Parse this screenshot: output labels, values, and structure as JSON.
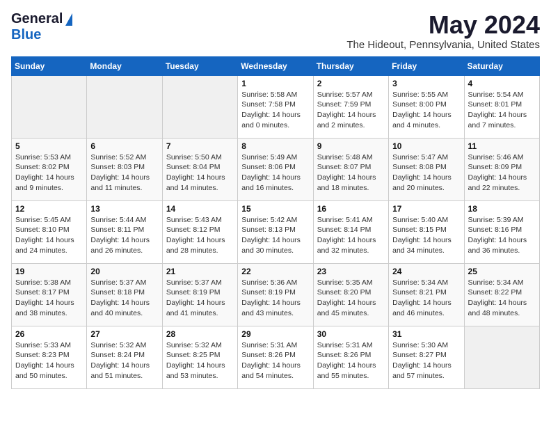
{
  "header": {
    "logo_general": "General",
    "logo_blue": "Blue",
    "title": "May 2024",
    "subtitle": "The Hideout, Pennsylvania, United States"
  },
  "days_of_week": [
    "Sunday",
    "Monday",
    "Tuesday",
    "Wednesday",
    "Thursday",
    "Friday",
    "Saturday"
  ],
  "weeks": [
    {
      "days": [
        {
          "num": "",
          "info": "",
          "empty": true
        },
        {
          "num": "",
          "info": "",
          "empty": true
        },
        {
          "num": "",
          "info": "",
          "empty": true
        },
        {
          "num": "1",
          "info": "Sunrise: 5:58 AM\nSunset: 7:58 PM\nDaylight: 14 hours\nand 0 minutes."
        },
        {
          "num": "2",
          "info": "Sunrise: 5:57 AM\nSunset: 7:59 PM\nDaylight: 14 hours\nand 2 minutes."
        },
        {
          "num": "3",
          "info": "Sunrise: 5:55 AM\nSunset: 8:00 PM\nDaylight: 14 hours\nand 4 minutes."
        },
        {
          "num": "4",
          "info": "Sunrise: 5:54 AM\nSunset: 8:01 PM\nDaylight: 14 hours\nand 7 minutes."
        }
      ]
    },
    {
      "days": [
        {
          "num": "5",
          "info": "Sunrise: 5:53 AM\nSunset: 8:02 PM\nDaylight: 14 hours\nand 9 minutes."
        },
        {
          "num": "6",
          "info": "Sunrise: 5:52 AM\nSunset: 8:03 PM\nDaylight: 14 hours\nand 11 minutes."
        },
        {
          "num": "7",
          "info": "Sunrise: 5:50 AM\nSunset: 8:04 PM\nDaylight: 14 hours\nand 14 minutes."
        },
        {
          "num": "8",
          "info": "Sunrise: 5:49 AM\nSunset: 8:06 PM\nDaylight: 14 hours\nand 16 minutes."
        },
        {
          "num": "9",
          "info": "Sunrise: 5:48 AM\nSunset: 8:07 PM\nDaylight: 14 hours\nand 18 minutes."
        },
        {
          "num": "10",
          "info": "Sunrise: 5:47 AM\nSunset: 8:08 PM\nDaylight: 14 hours\nand 20 minutes."
        },
        {
          "num": "11",
          "info": "Sunrise: 5:46 AM\nSunset: 8:09 PM\nDaylight: 14 hours\nand 22 minutes."
        }
      ]
    },
    {
      "days": [
        {
          "num": "12",
          "info": "Sunrise: 5:45 AM\nSunset: 8:10 PM\nDaylight: 14 hours\nand 24 minutes."
        },
        {
          "num": "13",
          "info": "Sunrise: 5:44 AM\nSunset: 8:11 PM\nDaylight: 14 hours\nand 26 minutes."
        },
        {
          "num": "14",
          "info": "Sunrise: 5:43 AM\nSunset: 8:12 PM\nDaylight: 14 hours\nand 28 minutes."
        },
        {
          "num": "15",
          "info": "Sunrise: 5:42 AM\nSunset: 8:13 PM\nDaylight: 14 hours\nand 30 minutes."
        },
        {
          "num": "16",
          "info": "Sunrise: 5:41 AM\nSunset: 8:14 PM\nDaylight: 14 hours\nand 32 minutes."
        },
        {
          "num": "17",
          "info": "Sunrise: 5:40 AM\nSunset: 8:15 PM\nDaylight: 14 hours\nand 34 minutes."
        },
        {
          "num": "18",
          "info": "Sunrise: 5:39 AM\nSunset: 8:16 PM\nDaylight: 14 hours\nand 36 minutes."
        }
      ]
    },
    {
      "days": [
        {
          "num": "19",
          "info": "Sunrise: 5:38 AM\nSunset: 8:17 PM\nDaylight: 14 hours\nand 38 minutes."
        },
        {
          "num": "20",
          "info": "Sunrise: 5:37 AM\nSunset: 8:18 PM\nDaylight: 14 hours\nand 40 minutes."
        },
        {
          "num": "21",
          "info": "Sunrise: 5:37 AM\nSunset: 8:19 PM\nDaylight: 14 hours\nand 41 minutes."
        },
        {
          "num": "22",
          "info": "Sunrise: 5:36 AM\nSunset: 8:19 PM\nDaylight: 14 hours\nand 43 minutes."
        },
        {
          "num": "23",
          "info": "Sunrise: 5:35 AM\nSunset: 8:20 PM\nDaylight: 14 hours\nand 45 minutes."
        },
        {
          "num": "24",
          "info": "Sunrise: 5:34 AM\nSunset: 8:21 PM\nDaylight: 14 hours\nand 46 minutes."
        },
        {
          "num": "25",
          "info": "Sunrise: 5:34 AM\nSunset: 8:22 PM\nDaylight: 14 hours\nand 48 minutes."
        }
      ]
    },
    {
      "days": [
        {
          "num": "26",
          "info": "Sunrise: 5:33 AM\nSunset: 8:23 PM\nDaylight: 14 hours\nand 50 minutes."
        },
        {
          "num": "27",
          "info": "Sunrise: 5:32 AM\nSunset: 8:24 PM\nDaylight: 14 hours\nand 51 minutes."
        },
        {
          "num": "28",
          "info": "Sunrise: 5:32 AM\nSunset: 8:25 PM\nDaylight: 14 hours\nand 53 minutes."
        },
        {
          "num": "29",
          "info": "Sunrise: 5:31 AM\nSunset: 8:26 PM\nDaylight: 14 hours\nand 54 minutes."
        },
        {
          "num": "30",
          "info": "Sunrise: 5:31 AM\nSunset: 8:26 PM\nDaylight: 14 hours\nand 55 minutes."
        },
        {
          "num": "31",
          "info": "Sunrise: 5:30 AM\nSunset: 8:27 PM\nDaylight: 14 hours\nand 57 minutes."
        },
        {
          "num": "",
          "info": "",
          "empty": true
        }
      ]
    }
  ]
}
